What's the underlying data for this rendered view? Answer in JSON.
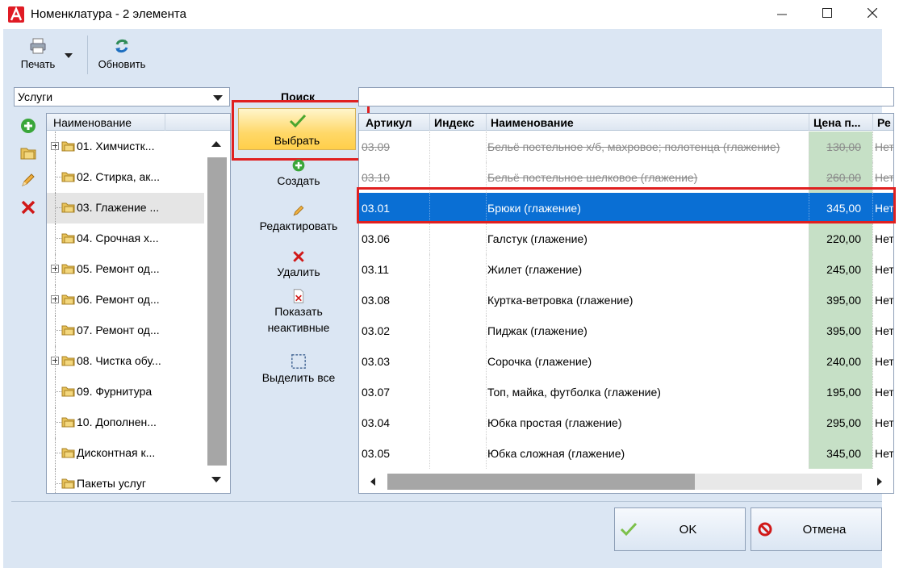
{
  "window": {
    "title": "Номенклатура - 2 элемента",
    "controls": [
      "minimize",
      "maximize",
      "close"
    ]
  },
  "toolbar": {
    "print_label": "Печать",
    "refresh_label": "Обновить"
  },
  "category_combo": {
    "value": "Услуги"
  },
  "tree": {
    "header": "Наименование",
    "items": [
      {
        "label": "01.  Химчистк...",
        "expandable": true
      },
      {
        "label": "02. Стирка, ак...",
        "expandable": false
      },
      {
        "label": "03. Глажение ...",
        "expandable": false,
        "selected": true
      },
      {
        "label": "04. Срочная х...",
        "expandable": false
      },
      {
        "label": "05. Ремонт од...",
        "expandable": true
      },
      {
        "label": "06. Ремонт од...",
        "expandable": true
      },
      {
        "label": "07. Ремонт од...",
        "expandable": false
      },
      {
        "label": "08. Чистка обу...",
        "expandable": true
      },
      {
        "label": "09. Фурнитура",
        "expandable": false
      },
      {
        "label": "10. Дополнен...",
        "expandable": false
      },
      {
        "label": "Дисконтная к...",
        "expandable": false
      },
      {
        "label": "Пакеты услуг",
        "expandable": false
      }
    ]
  },
  "actions": {
    "search_label": "Поиск",
    "select": "Выбрать",
    "create": "Создать",
    "edit": "Редактировать",
    "delete": "Удалить",
    "show_inactive_1": "Показать",
    "show_inactive_2": "неактивные",
    "select_all": "Выделить все"
  },
  "grid": {
    "columns": [
      "Артикул",
      "Индекс",
      "Наименование",
      "Цена п...",
      "Ре"
    ],
    "rows": [
      {
        "article": "03.09",
        "index": "",
        "name": "Бельё постельное х/б, махровое; полотенца (глажение)",
        "price": "130,00",
        "extra": "Нет",
        "state": "inactive"
      },
      {
        "article": "03.10",
        "index": "",
        "name": "Бельё постельное шелковое (глажение)",
        "price": "260,00",
        "extra": "Нет",
        "state": "inactive"
      },
      {
        "article": "03.01",
        "index": "",
        "name": "Брюки (глажение)",
        "price": "345,00",
        "extra": "Нет",
        "state": "selected"
      },
      {
        "article": "03.06",
        "index": "",
        "name": "Галстук (глажение)",
        "price": "220,00",
        "extra": "Нет",
        "state": "normal"
      },
      {
        "article": "03.11",
        "index": "",
        "name": "Жилет (глажение)",
        "price": "245,00",
        "extra": "Нет",
        "state": "normal"
      },
      {
        "article": "03.08",
        "index": "",
        "name": "Куртка-ветровка (глажение)",
        "price": "395,00",
        "extra": "Нет",
        "state": "normal"
      },
      {
        "article": "03.02",
        "index": "",
        "name": "Пиджак (глажение)",
        "price": "395,00",
        "extra": "Нет",
        "state": "normal"
      },
      {
        "article": "03.03",
        "index": "",
        "name": "Сорочка (глажение)",
        "price": "240,00",
        "extra": "Нет",
        "state": "normal"
      },
      {
        "article": "03.07",
        "index": "",
        "name": "Топ, майка, футболка (глажение)",
        "price": "195,00",
        "extra": "Нет",
        "state": "normal"
      },
      {
        "article": "03.04",
        "index": "",
        "name": "Юбка простая (глажение)",
        "price": "295,00",
        "extra": "Нет",
        "state": "normal"
      },
      {
        "article": "03.05",
        "index": "",
        "name": "Юбка сложная (глажение)",
        "price": "345,00",
        "extra": "Нет",
        "state": "normal"
      }
    ]
  },
  "dialog": {
    "ok": "OK",
    "cancel": "Отмена"
  },
  "colors": {
    "selection": "#0a6fd4",
    "price_column": "#c6e0c6",
    "highlight_box": "#e02020",
    "select_button": "#ffd868"
  }
}
